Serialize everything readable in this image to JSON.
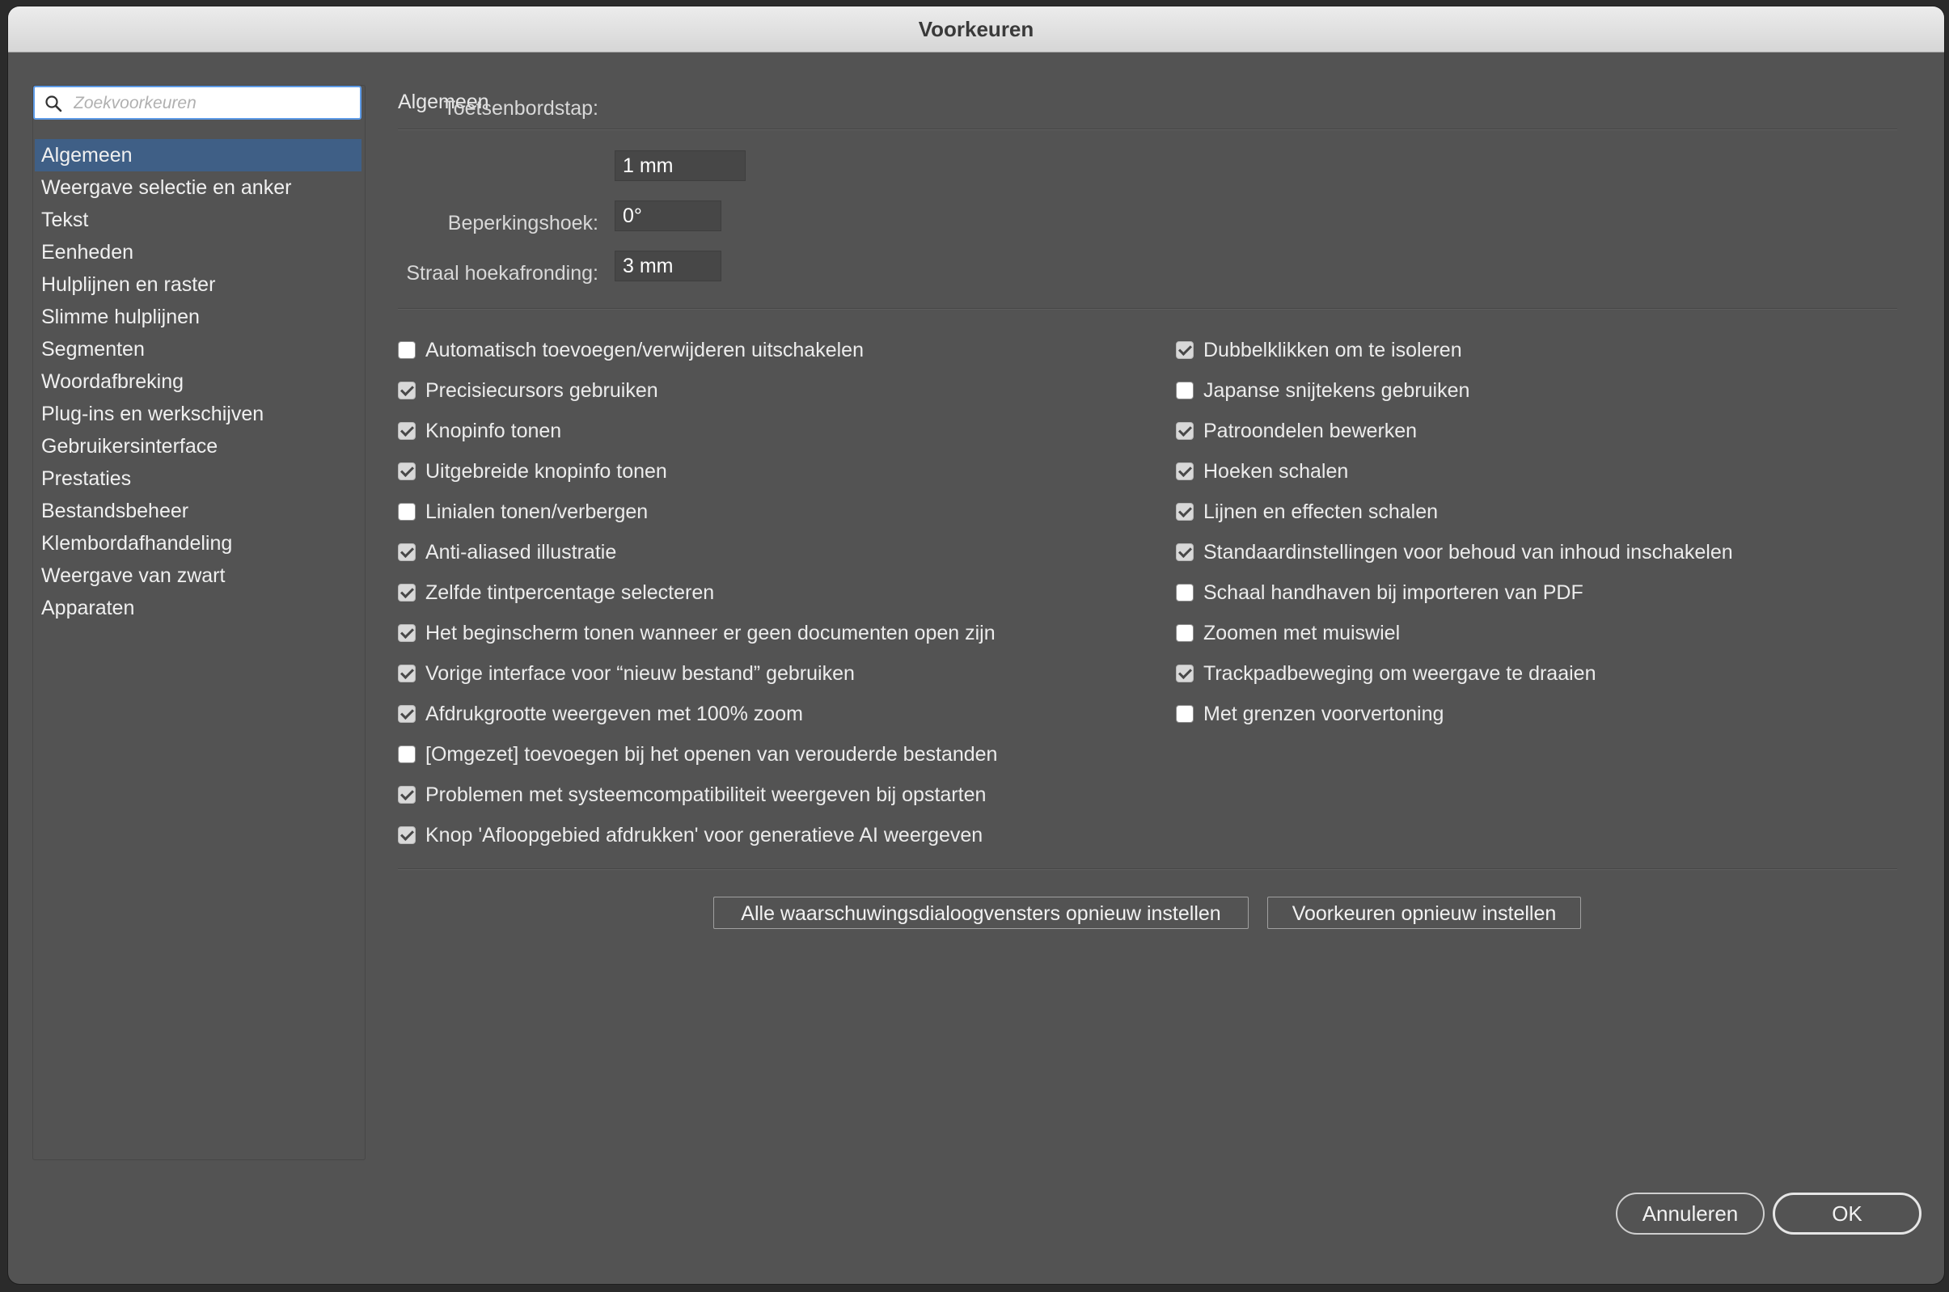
{
  "window": {
    "title": "Voorkeuren"
  },
  "search": {
    "placeholder": "Zoekvoorkeuren",
    "icon": "search-icon"
  },
  "sidebar": {
    "items": [
      {
        "label": "Algemeen",
        "active": true
      },
      {
        "label": "Weergave selectie en anker"
      },
      {
        "label": "Tekst"
      },
      {
        "label": "Eenheden"
      },
      {
        "label": "Hulplijnen en raster"
      },
      {
        "label": "Slimme hulplijnen"
      },
      {
        "label": "Segmenten"
      },
      {
        "label": "Woordafbreking"
      },
      {
        "label": "Plug-ins en werkschijven"
      },
      {
        "label": "Gebruikersinterface"
      },
      {
        "label": "Prestaties"
      },
      {
        "label": "Bestandsbeheer"
      },
      {
        "label": "Klembordafhandeling"
      },
      {
        "label": "Weergave van zwart"
      },
      {
        "label": "Apparaten"
      }
    ]
  },
  "main": {
    "section_title": "Algemeen",
    "fields": [
      {
        "label": "Toetsenbordstap:",
        "value": "1 mm"
      },
      {
        "label": "Beperkingshoek:",
        "value": "0°"
      },
      {
        "label": "Straal hoekafronding:",
        "value": "3 mm"
      }
    ],
    "left_options": [
      {
        "label": "Automatisch toevoegen/verwijderen uitschakelen",
        "checked": false
      },
      {
        "label": "Precisiecursors gebruiken",
        "checked": true
      },
      {
        "label": "Knopinfo tonen",
        "checked": true
      },
      {
        "label": "Uitgebreide knopinfo tonen",
        "checked": true
      },
      {
        "label": "Linialen tonen/verbergen",
        "checked": false
      },
      {
        "label": "Anti-aliased illustratie",
        "checked": true
      },
      {
        "label": "Zelfde tintpercentage selecteren",
        "checked": true
      },
      {
        "label": "Het beginscherm tonen wanneer er geen documenten open zijn",
        "checked": true
      },
      {
        "label": "Vorige interface voor “nieuw bestand” gebruiken",
        "checked": true
      },
      {
        "label": "Afdrukgrootte weergeven met 100% zoom",
        "checked": true
      },
      {
        "label": "[Omgezet] toevoegen bij het openen van verouderde bestanden",
        "checked": false
      },
      {
        "label": "Problemen met systeemcompatibiliteit weergeven bij opstarten",
        "checked": true
      },
      {
        "label": "Knop 'Afloopgebied afdrukken' voor generatieve AI weergeven",
        "checked": true
      }
    ],
    "right_options": [
      {
        "label": "Dubbelklikken om te isoleren",
        "checked": true
      },
      {
        "label": "Japanse snijtekens gebruiken",
        "checked": false
      },
      {
        "label": "Patroondelen bewerken",
        "checked": true
      },
      {
        "label": "Hoeken schalen",
        "checked": true
      },
      {
        "label": "Lijnen en effecten schalen",
        "checked": true
      },
      {
        "label": "Standaardinstellingen voor behoud van inhoud inschakelen",
        "checked": true
      },
      {
        "label": "Schaal handhaven bij importeren van PDF",
        "checked": false
      },
      {
        "label": "Zoomen met muiswiel",
        "checked": false
      },
      {
        "label": "Trackpadbeweging om weergave te draaien",
        "checked": true
      },
      {
        "label": "Met grenzen voorvertoning",
        "checked": false
      }
    ],
    "reset_warnings_label": "Alle waarschuwingsdialoogvensters opnieuw instellen",
    "reset_prefs_label": "Voorkeuren opnieuw instellen"
  },
  "footer": {
    "cancel_label": "Annuleren",
    "ok_label": "OK"
  }
}
